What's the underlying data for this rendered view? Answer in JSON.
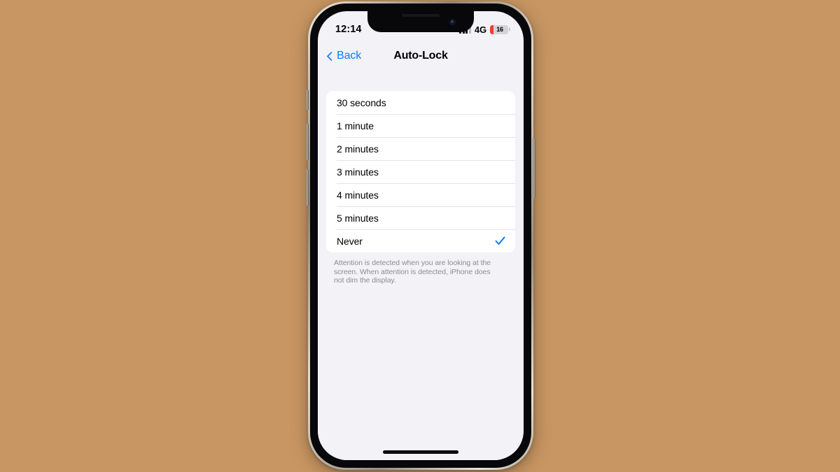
{
  "background_color": "#c89662",
  "device": {
    "name": "iphone-frame",
    "frame_color": "#b8b2a7",
    "bezel_color": "#08080a",
    "screen_background": "#f2f2f7"
  },
  "status_bar": {
    "time": "12:14",
    "carrier_network": "4G",
    "signal_bars_total": 4,
    "signal_bars_active": 3,
    "battery_level": "16",
    "battery_percent": 16,
    "battery_color": "#f23c2e"
  },
  "nav_bar": {
    "back_label": "Back",
    "back_icon": "chevron-left-icon",
    "title": "Auto-Lock",
    "accent_color": "#0a7cff"
  },
  "options": {
    "selected_index": 6,
    "check_icon": "checkmark-icon",
    "check_color": "#0a7cff",
    "items": [
      {
        "label": "30 seconds",
        "selected": false
      },
      {
        "label": "1 minute",
        "selected": false
      },
      {
        "label": "2 minutes",
        "selected": false
      },
      {
        "label": "3 minutes",
        "selected": false
      },
      {
        "label": "4 minutes",
        "selected": false
      },
      {
        "label": "5 minutes",
        "selected": false
      },
      {
        "label": "Never",
        "selected": true
      }
    ]
  },
  "footer": {
    "note": "Attention is detected when you are looking at the screen. When attention is detected, iPhone does not dim the display."
  },
  "home_indicator": {
    "label": "home-indicator"
  }
}
